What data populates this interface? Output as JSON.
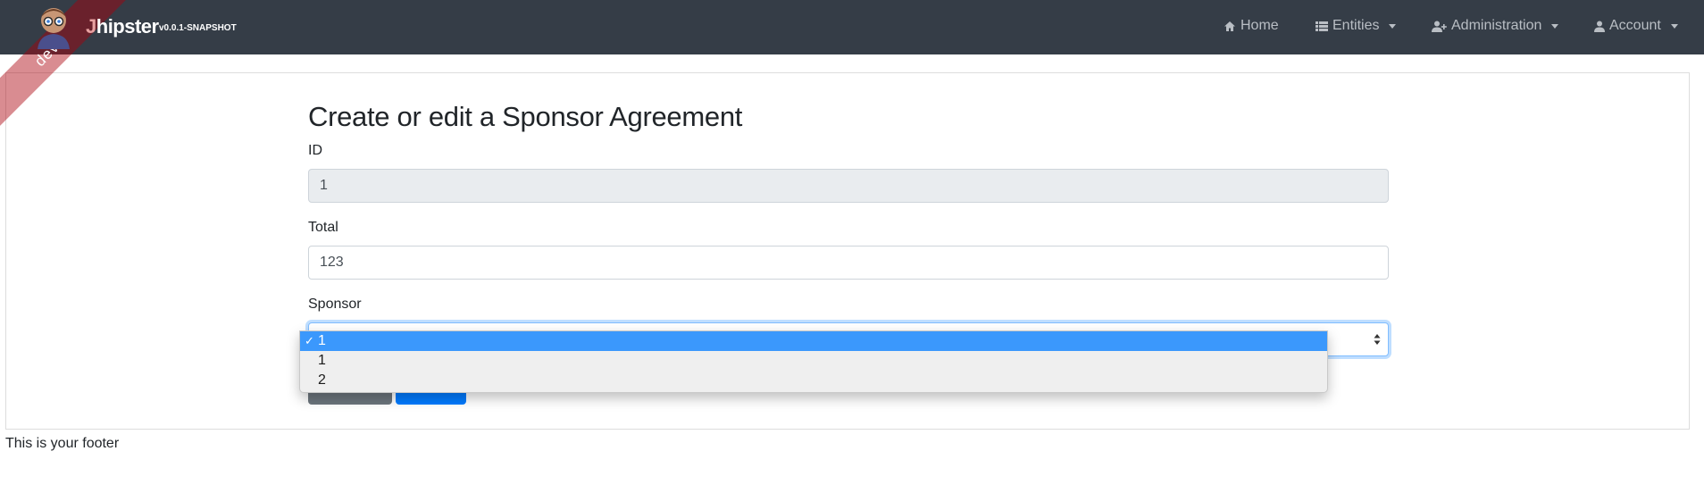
{
  "navbar": {
    "ribbon_text": "dev",
    "brand_prefix": "J",
    "brand_rest": "hipster",
    "version": "v0.0.1-SNAPSHOT",
    "items": [
      {
        "label": "Home",
        "icon": "home-icon"
      },
      {
        "label": "Entities",
        "icon": "th-list-icon"
      },
      {
        "label": "Administration",
        "icon": "user-plus-icon"
      },
      {
        "label": "Account",
        "icon": "user-icon"
      }
    ]
  },
  "form": {
    "title": "Create or edit a Sponsor Agreement",
    "id_label": "ID",
    "id_value": "1",
    "total_label": "Total",
    "total_value": "123",
    "sponsor_label": "Sponsor",
    "sponsor_value": "1"
  },
  "sponsor_dropdown": {
    "options": [
      {
        "label": "1",
        "selected": true
      },
      {
        "label": "1",
        "selected": false
      },
      {
        "label": "2",
        "selected": false
      }
    ],
    "check_mark": "✓"
  },
  "footer": {
    "text": "This is your footer"
  },
  "colors": {
    "navbar_bg": "#353d47",
    "primary": "#007bff",
    "secondary": "#6c757d",
    "dropdown_highlight": "#3b98fc"
  }
}
